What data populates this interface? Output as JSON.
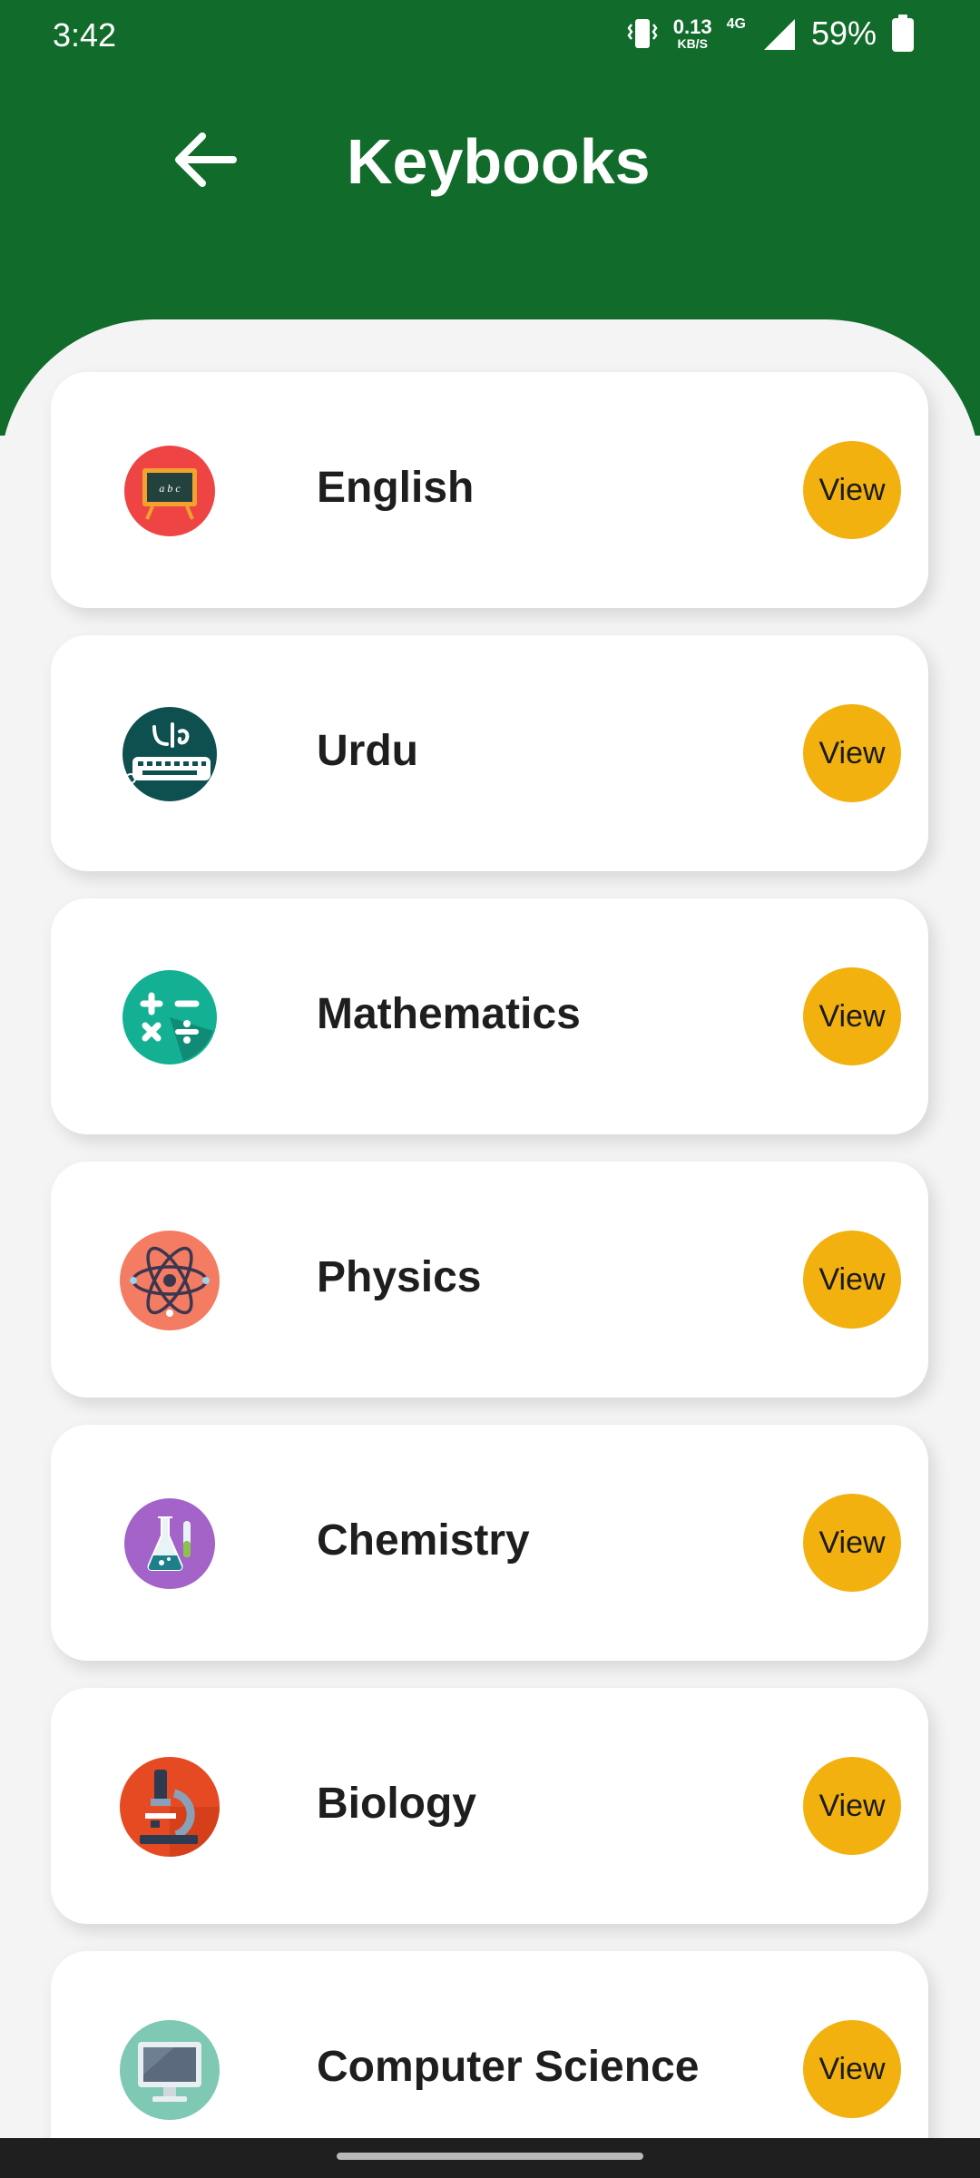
{
  "status_bar": {
    "time": "3:42",
    "net_speed": "0.13",
    "net_unit": "KB/S",
    "network": "4G",
    "battery": "59%"
  },
  "header": {
    "title": "Keybooks",
    "back_icon": "arrow-left-icon",
    "color": "#116b2b"
  },
  "subjects": [
    {
      "label": "English",
      "icon": "chalkboard-icon",
      "button": "View"
    },
    {
      "label": "Urdu",
      "icon": "urdu-keyboard-icon",
      "button": "View"
    },
    {
      "label": "Mathematics",
      "icon": "math-operators-icon",
      "button": "View"
    },
    {
      "label": "Physics",
      "icon": "atom-icon",
      "button": "View"
    },
    {
      "label": "Chemistry",
      "icon": "flask-icon",
      "button": "View"
    },
    {
      "label": "Biology",
      "icon": "microscope-icon",
      "button": "View"
    },
    {
      "label": "Computer Science",
      "icon": "computer-monitor-icon",
      "button": "View"
    }
  ],
  "colors": {
    "accent": "#f2b10f",
    "card": "#ffffff",
    "background": "#f4f4f4"
  }
}
